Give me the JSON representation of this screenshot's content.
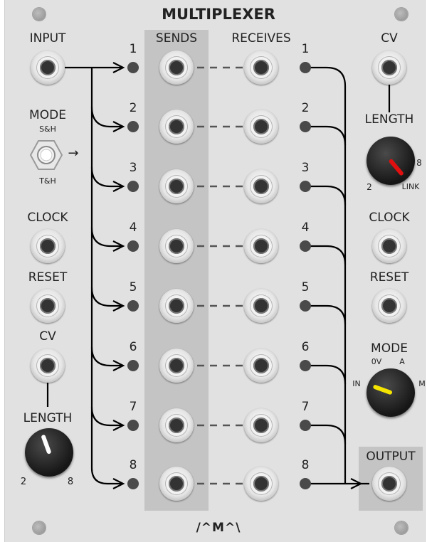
{
  "title": "MULTIPLEXER",
  "logo": "/^M^\\",
  "left": {
    "input": "INPUT",
    "mode": "MODE",
    "mode_top": "S&H",
    "mode_bottom": "T&H",
    "mode_arrow": "→",
    "clock": "CLOCK",
    "reset": "RESET",
    "cv": "CV",
    "length": "LENGTH",
    "length_min": "2",
    "length_max": "8",
    "length_pointer_color": "#ffffff"
  },
  "sends": "SENDS",
  "receives": "RECEIVES",
  "channels": [
    "1",
    "2",
    "3",
    "4",
    "5",
    "6",
    "7",
    "8"
  ],
  "right": {
    "cv": "CV",
    "length": "LENGTH",
    "length_min": "2",
    "length_max": "8",
    "length_link": "LINK",
    "length_pointer_color": "#e01010",
    "clock": "CLOCK",
    "reset": "RESET",
    "mode": "MODE",
    "mode_0v": "0V",
    "mode_a": "A",
    "mode_in": "IN",
    "mode_m": "M",
    "mode_pointer_color": "#f5e400",
    "output": "OUTPUT"
  }
}
